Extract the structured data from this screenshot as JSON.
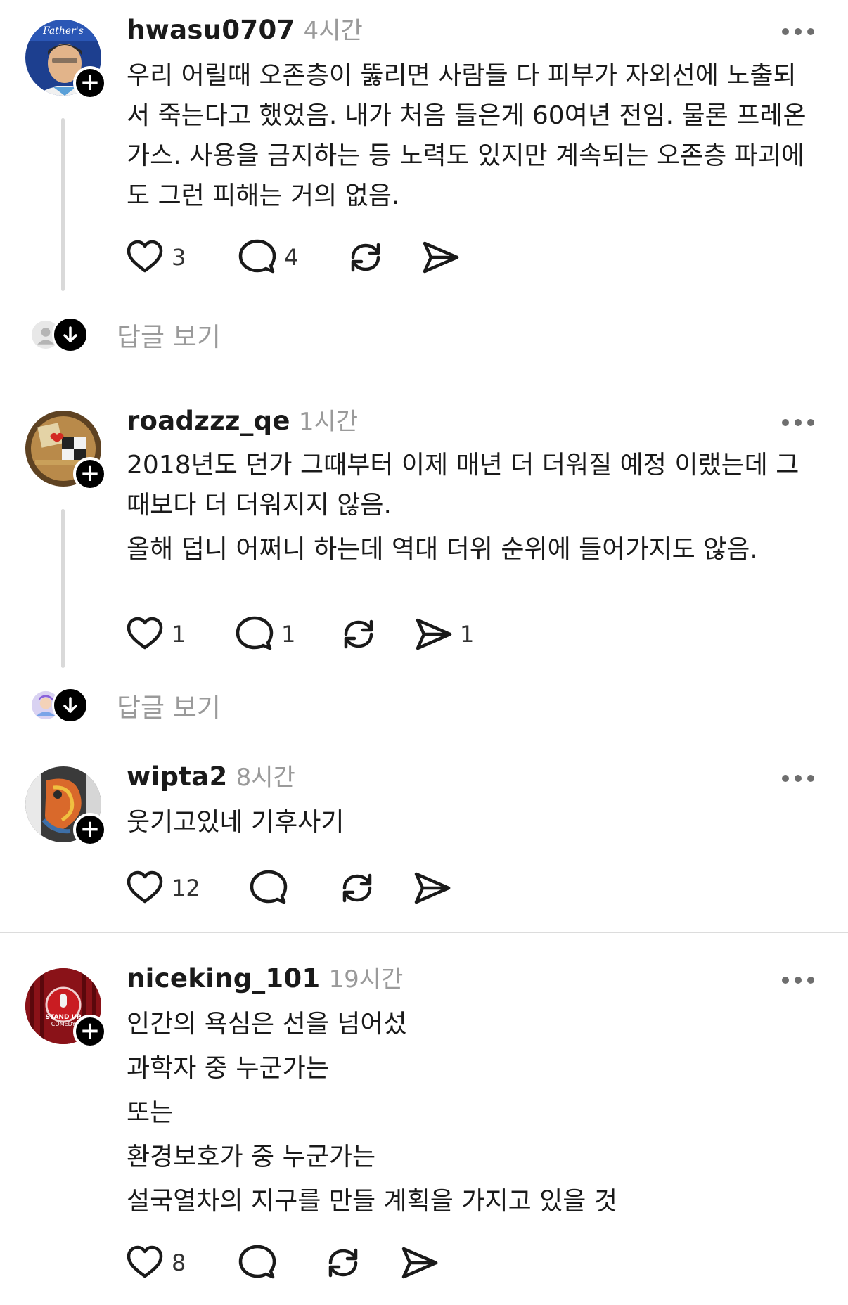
{
  "posts": [
    {
      "username": "hwasu0707",
      "time": "4시간",
      "lines": [
        "우리 어릴때 오존층이 뚫리면 사람들 다 피부가 자외선에 노출되",
        "서 죽는다고 했었음. 내가 처음 들은게 60여년 전임.  물론 프레온",
        "가스. 사용을 금지하는 등 노력도 있지만 계속되는 오존층 파괴에",
        "도  그런 피해는 거의 없음."
      ],
      "likes": "3",
      "comments": "4",
      "shares": "",
      "replies_label": "답글 보기",
      "avatar_colors": [
        "#1d3f8f",
        "#e8c9a2"
      ]
    },
    {
      "username": "roadzzz_qe",
      "time": "1시간",
      "lines": [
        "2018년도 던가 그때부터 이제 매년 더 더워질 예정 이랬는데 그",
        "때보다 더 더워지지 않음.",
        "올해 덥니 어쩌니 하는데 역대 더위 순위에 들어가지도 않음."
      ],
      "likes": "1",
      "comments": "1",
      "shares": "1",
      "replies_label": "답글 보기",
      "avatar_colors": [
        "#7a5a2e",
        "#c43a2a"
      ]
    },
    {
      "username": "wipta2",
      "time": "8시간",
      "lines": [
        "웃기고있네 기후사기"
      ],
      "likes": "12",
      "comments": "",
      "shares": ""
    },
    {
      "username": "niceking_101",
      "time": "19시간",
      "lines": [
        "인간의 욕심은 선을 넘어섰",
        "과학자 중 누군가는",
        "또는",
        "환경보호가 중 누군가는",
        "설국열차의 지구를 만들 계획을 가지고 있을 것"
      ],
      "likes": "8",
      "comments": "",
      "shares": "",
      "avatar_colors": [
        "#7a0d12",
        "#c91c22"
      ]
    }
  ],
  "follow_symbol": "+",
  "icons": {
    "like": "heart-icon",
    "comment": "comment-icon",
    "repost": "repost-icon",
    "share": "share-icon",
    "more": "more-icon",
    "replies": "arrow-down-icon"
  },
  "colors": {
    "text": "#1a1a1a",
    "muted": "#9a9a9a",
    "divider": "#dcdcdc",
    "thread_line": "#d9d9d9"
  }
}
